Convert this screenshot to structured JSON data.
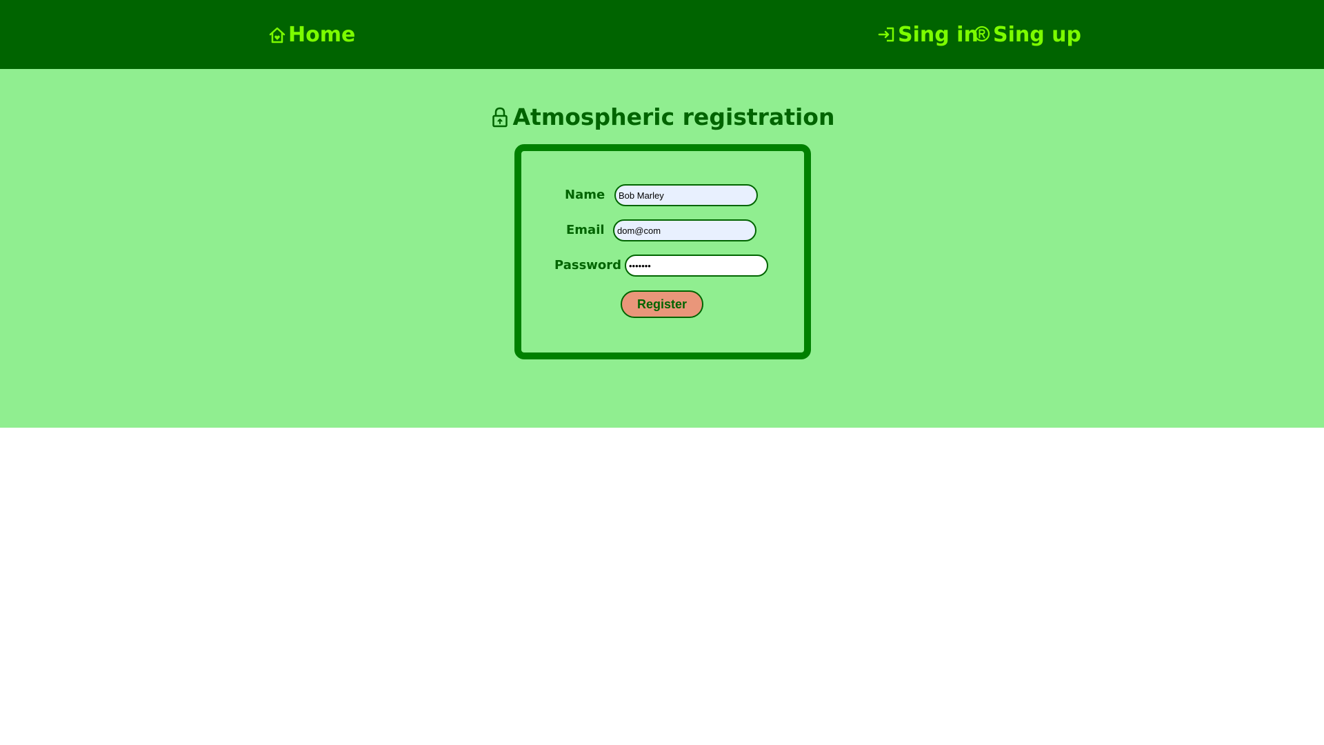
{
  "nav": {
    "home_label": "Home",
    "signin_label": "Sing in",
    "signup_label": "Sing up",
    "icons": {
      "home": "home-icon",
      "signin": "sign-in-icon",
      "signup": "registered-icon"
    }
  },
  "page": {
    "title": "Atmospheric registration",
    "title_icon": "lock-icon"
  },
  "form": {
    "name_label": "Name",
    "name_value": "Bob Marley",
    "email_label": "Email",
    "email_value": "dom@com",
    "password_label": "Password",
    "password_value": "1234567",
    "register_label": "Register"
  },
  "colors": {
    "header_bg": "#006400",
    "nav_text": "#7cfc00",
    "main_bg": "#90ee90",
    "form_border": "#008000",
    "text_dark_green": "#006400",
    "button_bg": "#e9967a",
    "autofill_bg": "#e8f0fe"
  }
}
